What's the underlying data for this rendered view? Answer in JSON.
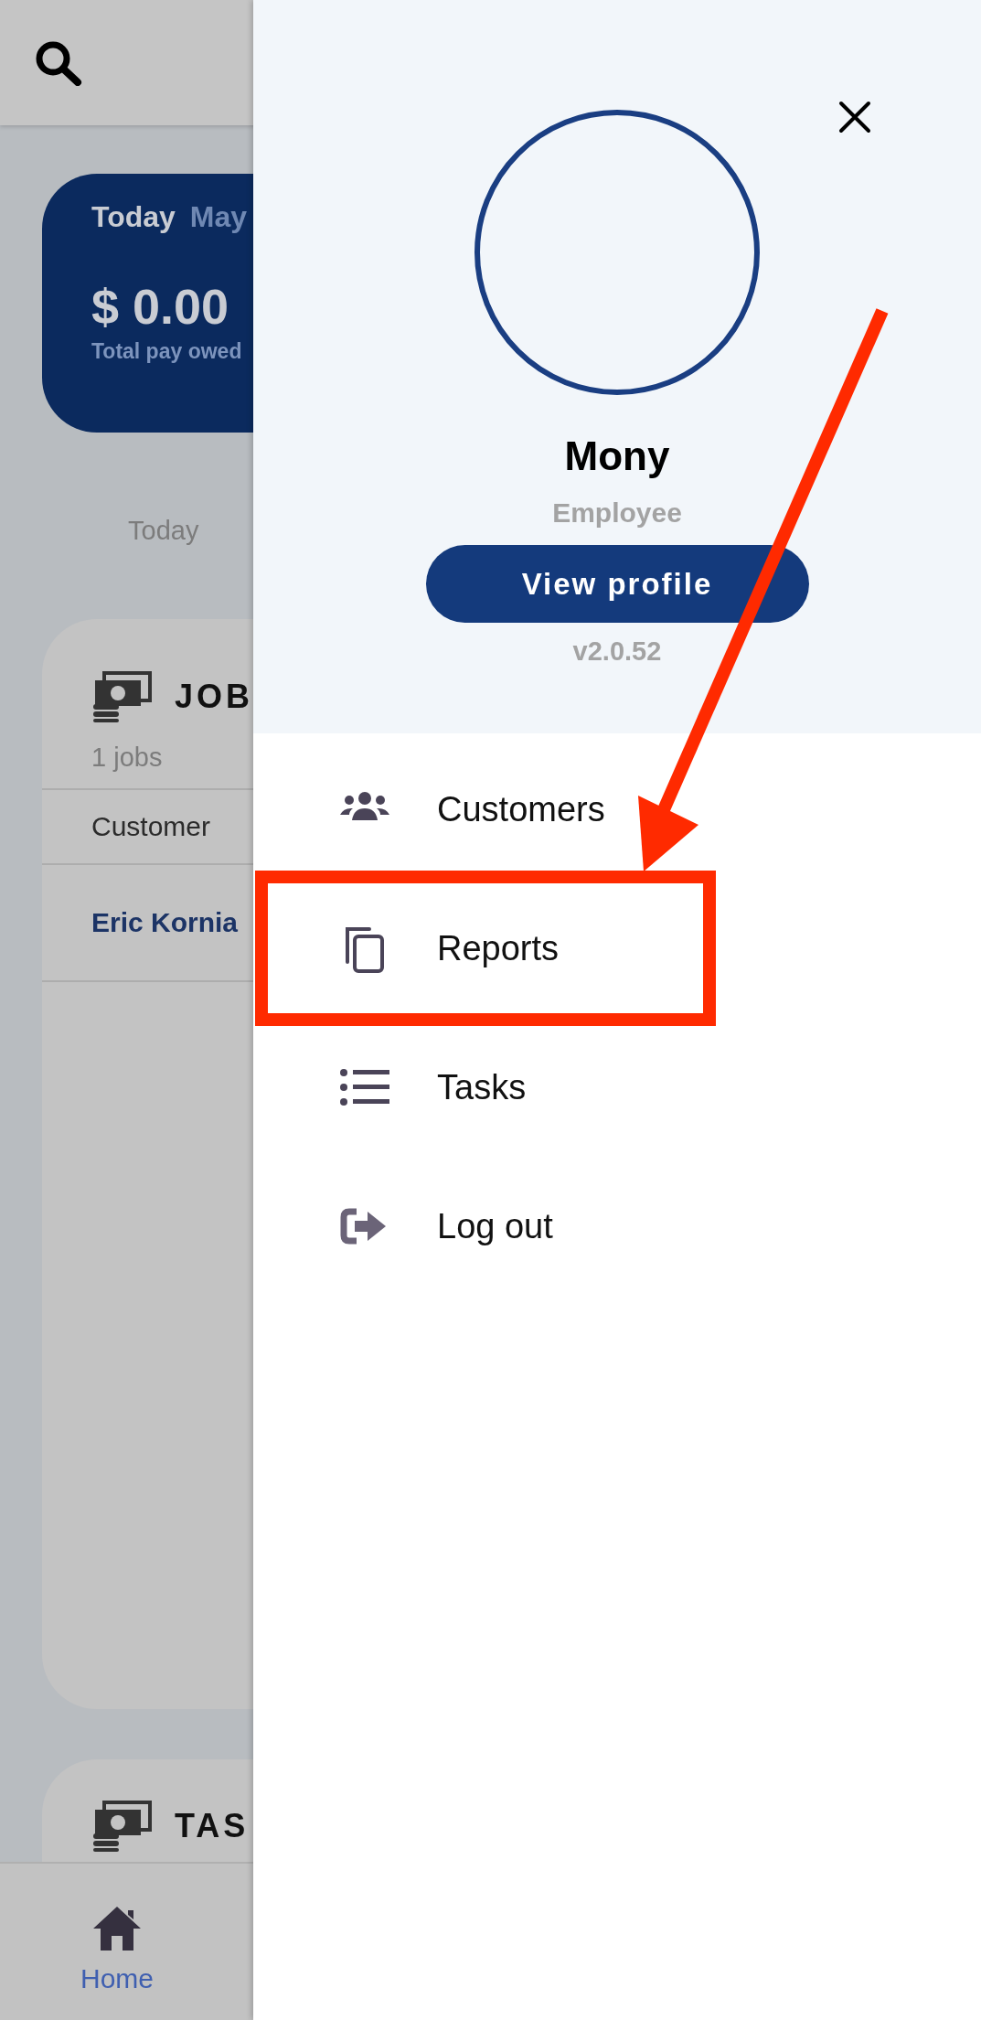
{
  "background_screen": {
    "summary_card": {
      "tabs": [
        {
          "label": "Today",
          "selected": true
        },
        {
          "label": "May",
          "selected": false
        }
      ],
      "amount": "$ 0.00",
      "caption": "Total pay owed"
    },
    "period_label": "Today",
    "jobs_card": {
      "title": "JOB",
      "count": "1 jobs",
      "column_1": "Customer",
      "rows": [
        {
          "customer": "Eric Kornia"
        }
      ]
    },
    "tasks_card": {
      "title": "TAS"
    },
    "bottom_nav": [
      {
        "label": "Home",
        "selected": true
      }
    ]
  },
  "drawer": {
    "profile": {
      "name": "Mony",
      "role": "Employee",
      "button": "View profile",
      "version": "v2.0.52"
    },
    "menu": [
      {
        "label": "Customers",
        "kind": "customers",
        "highlighted": false
      },
      {
        "label": "Reports",
        "kind": "reports",
        "highlighted": true
      },
      {
        "label": "Tasks",
        "kind": "tasks",
        "highlighted": false
      },
      {
        "label": "Log out",
        "kind": "logout",
        "highlighted": false
      }
    ]
  }
}
